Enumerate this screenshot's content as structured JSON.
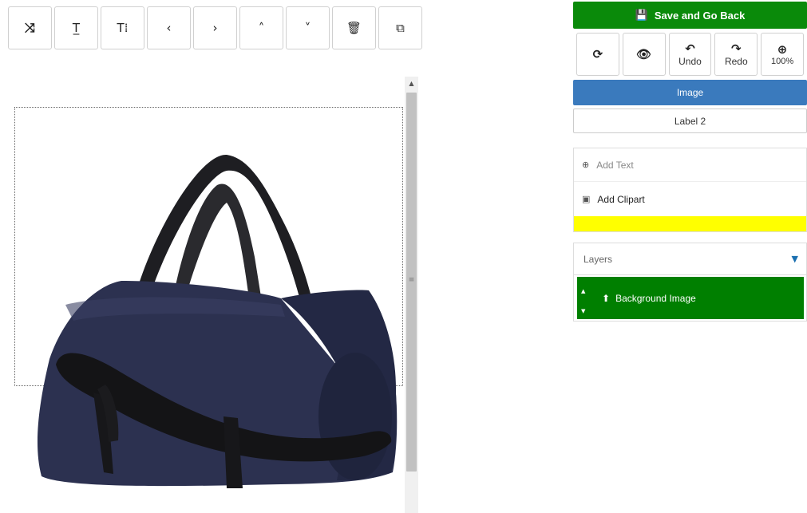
{
  "toolbar": {
    "buttons": [
      {
        "name": "shuffle-icon",
        "glyph": "⤨"
      },
      {
        "name": "text-icon",
        "glyph": "T̲"
      },
      {
        "name": "text-height-icon",
        "glyph": "T⁞"
      },
      {
        "name": "chevron-left-icon",
        "glyph": "‹"
      },
      {
        "name": "chevron-right-icon",
        "glyph": "›"
      },
      {
        "name": "chevron-up-icon",
        "glyph": "˄"
      },
      {
        "name": "chevron-down-icon",
        "glyph": "˅"
      },
      {
        "name": "trash-icon",
        "glyph": "🗑"
      },
      {
        "name": "clone-icon",
        "glyph": "⧉"
      }
    ]
  },
  "right_panel": {
    "save_label": "Save and Go Back",
    "save_icon": "💾",
    "tools": [
      {
        "name": "refresh-icon",
        "glyph": "⟳",
        "label": ""
      },
      {
        "name": "eye-icon",
        "glyph": "👁",
        "label": ""
      },
      {
        "name": "undo-icon",
        "glyph": "↶",
        "label": "Undo"
      },
      {
        "name": "redo-icon",
        "glyph": "↷",
        "label": "Redo"
      },
      {
        "name": "zoom-icon",
        "glyph": "⊕",
        "label": "100%"
      }
    ],
    "tab_image": "Image",
    "tab_label": "Label 2",
    "add_text": "Add Text",
    "add_text_icon": "⊕",
    "add_clipart": "Add Clipart",
    "add_clipart_icon": "▣",
    "layers_title": "Layers",
    "layers_caret": "▼",
    "layer_up_icon": "▲",
    "layer_down_icon": "▼",
    "layer_name": "Background Image",
    "layer_upload_icon": "⬆"
  },
  "colors": {
    "save_green": "#0a8a0a",
    "image_blue": "#3a7abd",
    "layer_green": "#007f00",
    "highlight_yellow": "#ffff00"
  }
}
